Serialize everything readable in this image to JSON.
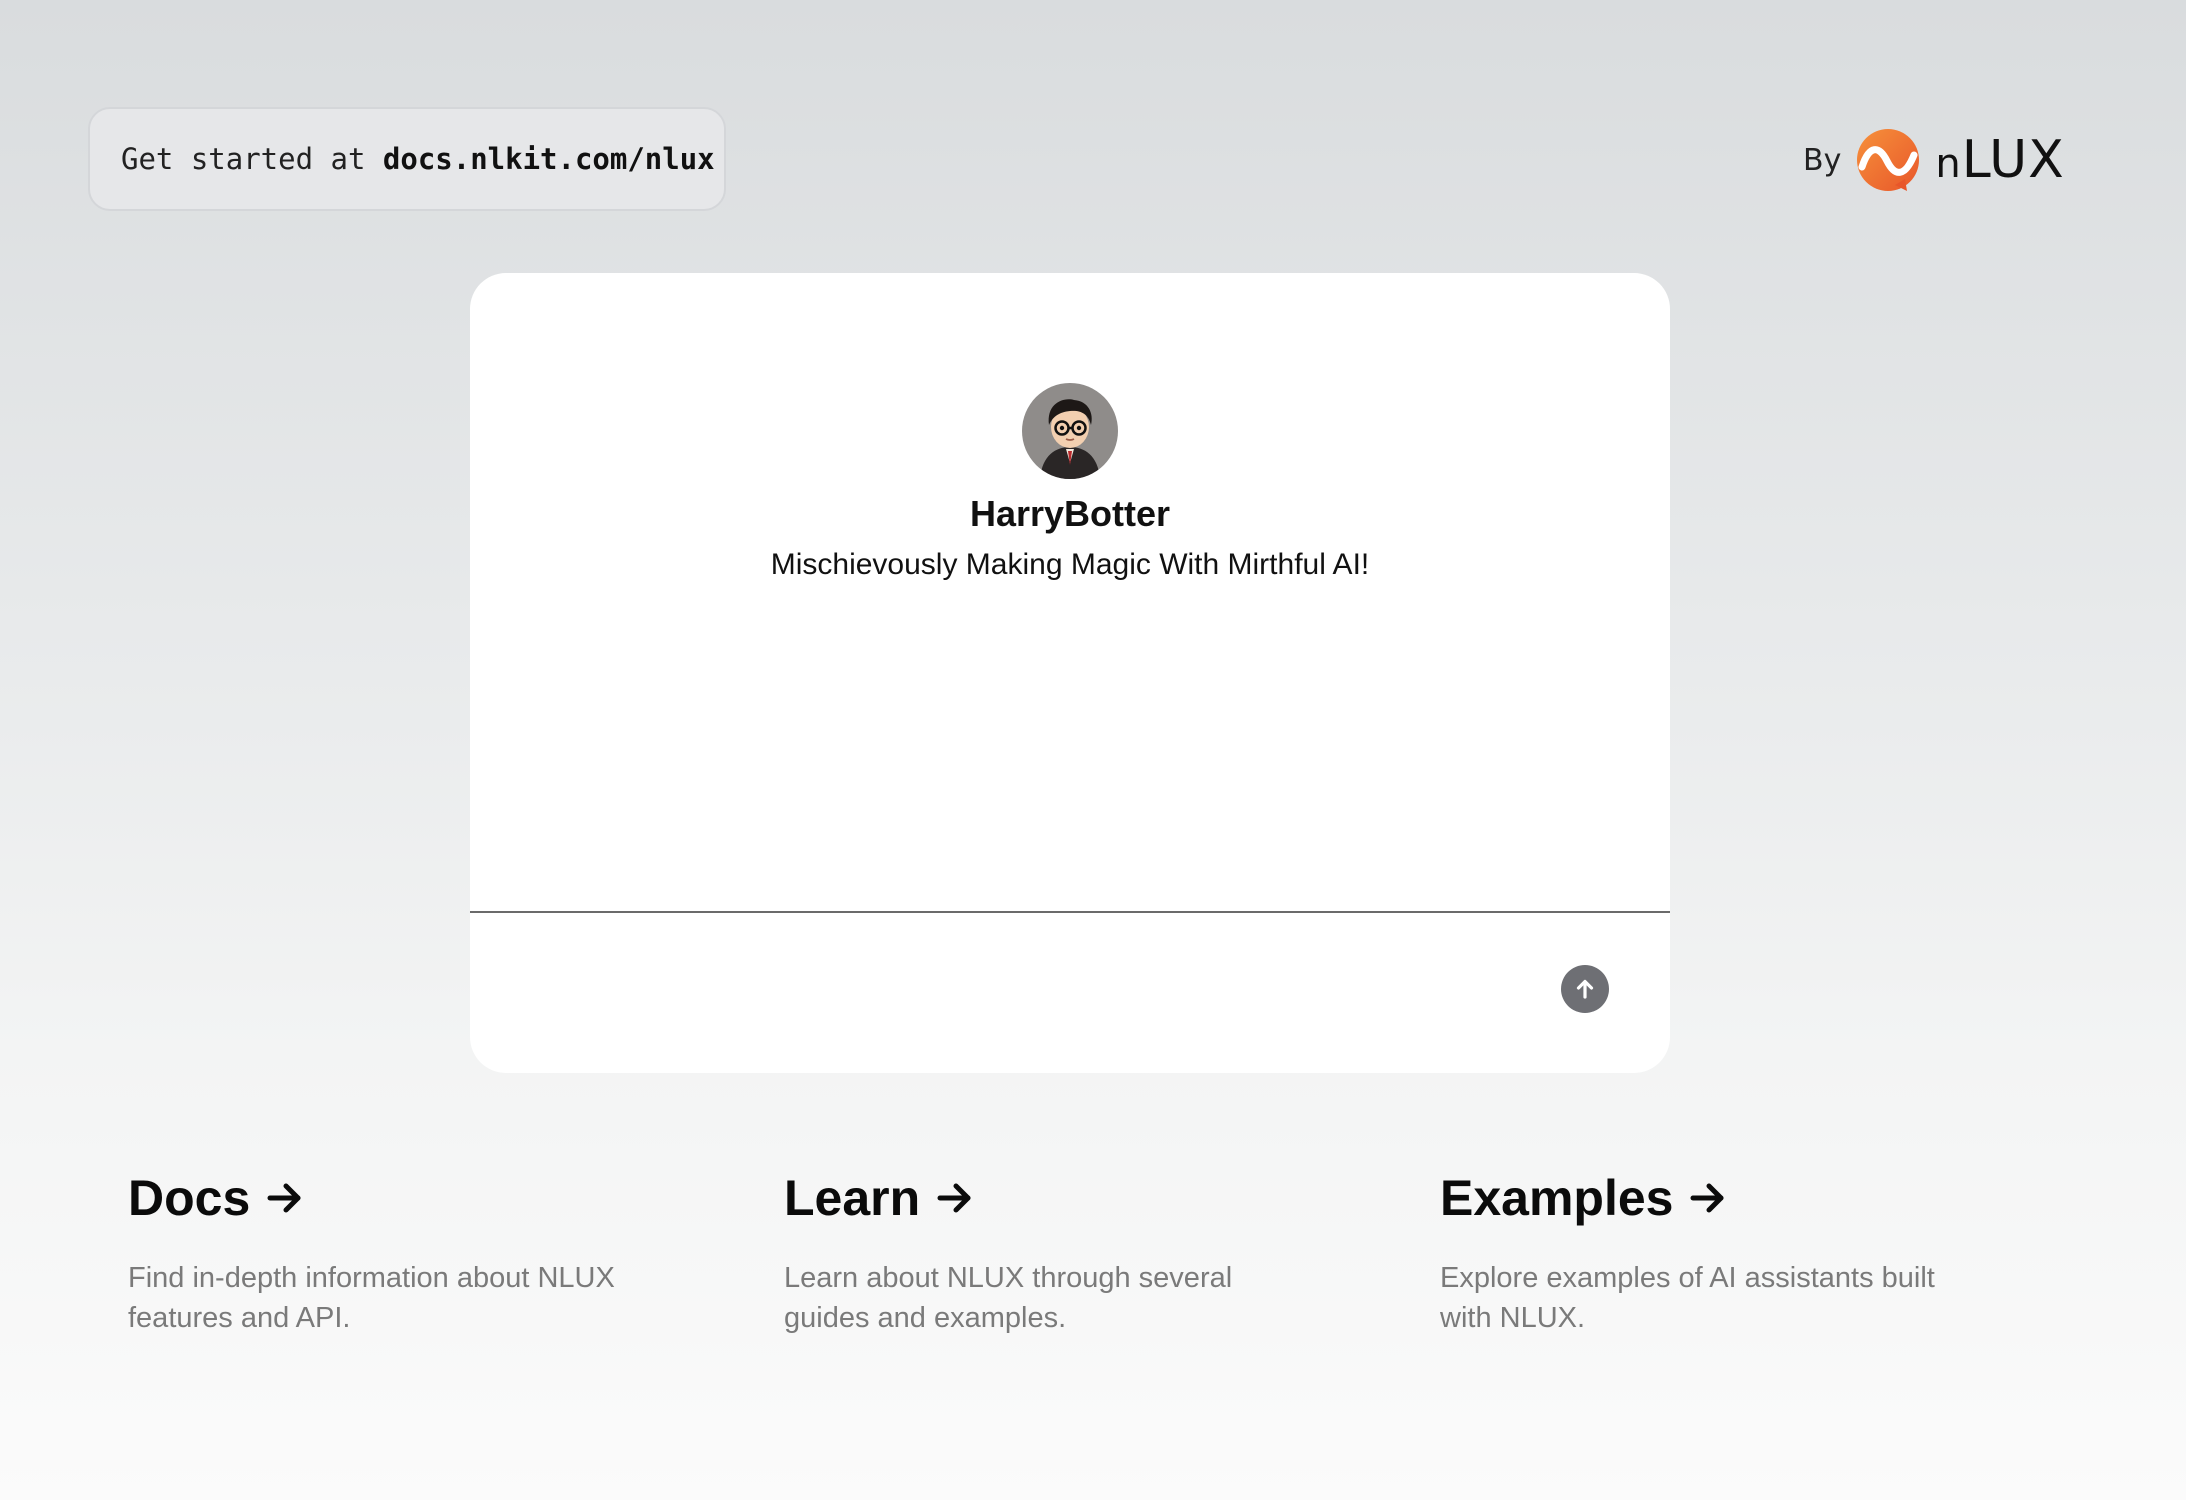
{
  "header": {
    "get_started_prefix": "Get started at ",
    "get_started_url": "docs.nlkit.com/nlux"
  },
  "brand": {
    "by_label": "By",
    "logo_icon": "nlux-logo-icon",
    "wordmark_n": "n",
    "wordmark_rest": "LUX",
    "accent_color": "#ef6a2a"
  },
  "chat": {
    "persona_name": "HarryBotter",
    "persona_tagline": "Mischievously Making Magic With Mirthful AI!",
    "avatar_icon": "wizard-avatar",
    "input_value": "",
    "input_placeholder": "",
    "send_icon": "arrow-up-icon"
  },
  "links": [
    {
      "title": "Docs",
      "description": "Find in-depth information about NLUX features and API."
    },
    {
      "title": "Learn",
      "description": "Learn about NLUX through several guides and examples."
    },
    {
      "title": "Examples",
      "description": "Explore examples of AI assistants built with NLUX."
    }
  ]
}
